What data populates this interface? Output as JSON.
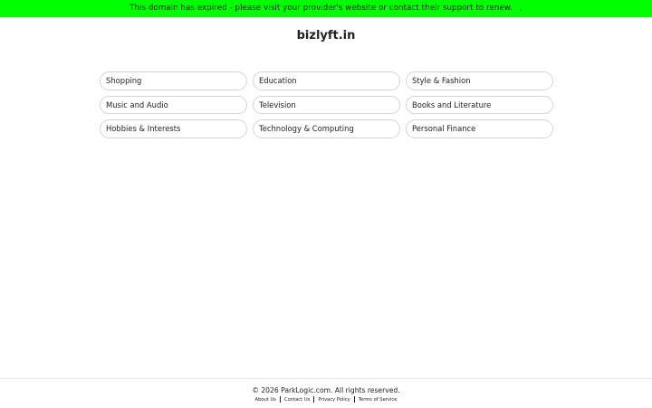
{
  "banner": {
    "message": "This domain has expired - please visit your provider's website or contact their support to renew.",
    "trailing": ","
  },
  "site": {
    "title": "bizlyft.in"
  },
  "categories": [
    "Shopping",
    "Education",
    "Style & Fashion",
    "Music and Audio",
    "Television",
    "Books and Literature",
    "Hobbies & Interests",
    "Technology & Computing",
    "Personal Finance"
  ],
  "footer": {
    "copyright": "© 2026 ParkLogic.com. All rights reserved.",
    "links": [
      "About Us",
      "Contact Us",
      "Privacy Policy",
      "Terms of Service"
    ]
  },
  "colors": {
    "banner_bg": "#00ff00",
    "pill_border": "#d4d4d4",
    "text": "#222222"
  }
}
